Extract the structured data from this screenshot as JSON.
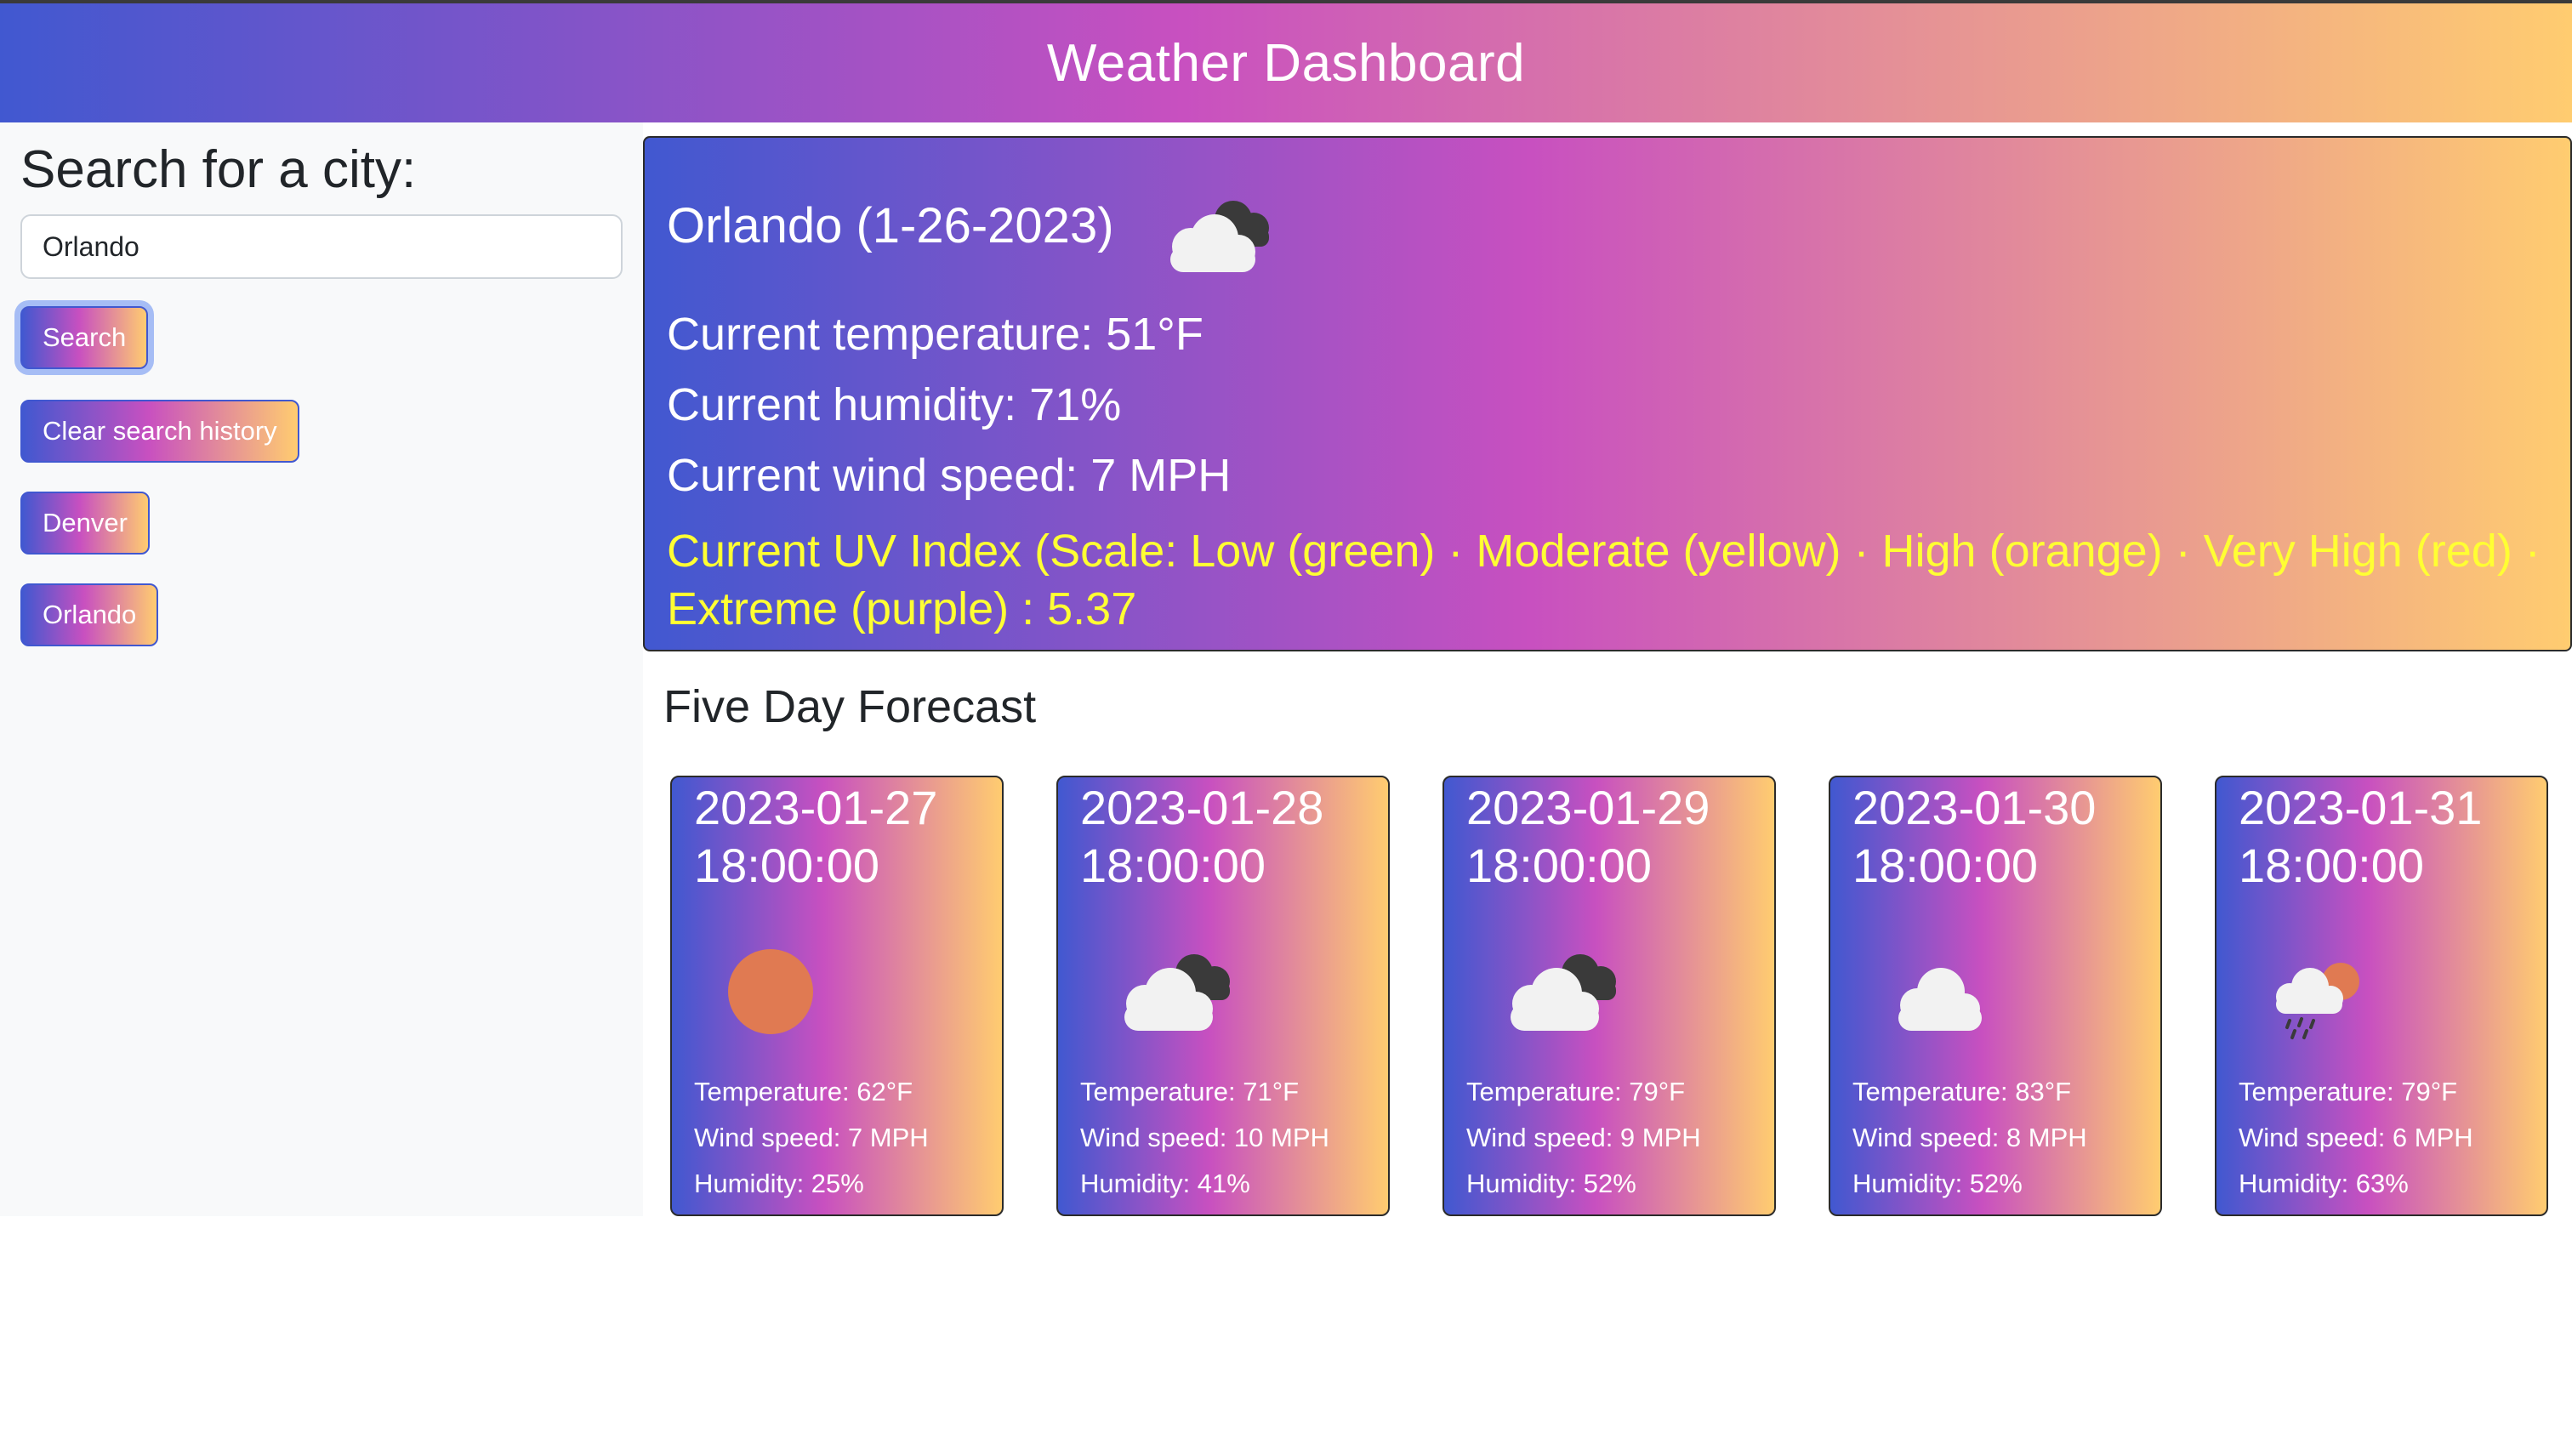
{
  "header": {
    "title": "Weather Dashboard"
  },
  "sidebar": {
    "heading": "Search for a city:",
    "search_value": "Orlando",
    "search_button": "Search",
    "clear_button": "Clear search history",
    "history": [
      "Denver",
      "Orlando"
    ]
  },
  "current": {
    "title": "Orlando (1-26-2023)",
    "icon": "cloudy-icon",
    "temperature": "Current temperature: 51°F",
    "humidity": "Current humidity: 71%",
    "wind": "Current wind speed: 7 MPH",
    "uv": "Current UV Index (Scale: Low (green) · Moderate (yellow) · High (orange) · Very High (red) · Extreme (purple) : 5.37"
  },
  "forecast": {
    "heading": "Five Day Forecast",
    "days": [
      {
        "date": "2023-01-27 18:00:00",
        "icon": "sun-icon",
        "temp": "Temperature: 62°F",
        "wind": "Wind speed: 7 MPH",
        "humidity": "Humidity: 25%"
      },
      {
        "date": "2023-01-28 18:00:00",
        "icon": "cloudy-icon",
        "temp": "Temperature: 71°F",
        "wind": "Wind speed: 10 MPH",
        "humidity": "Humidity: 41%"
      },
      {
        "date": "2023-01-29 18:00:00",
        "icon": "cloudy-icon",
        "temp": "Temperature: 79°F",
        "wind": "Wind speed: 9 MPH",
        "humidity": "Humidity: 52%"
      },
      {
        "date": "2023-01-30 18:00:00",
        "icon": "cloud-icon",
        "temp": "Temperature: 83°F",
        "wind": "Wind speed: 8 MPH",
        "humidity": "Humidity: 52%"
      },
      {
        "date": "2023-01-31 18:00:00",
        "icon": "rain-sun-icon",
        "temp": "Temperature: 79°F",
        "wind": "Wind speed: 6 MPH",
        "humidity": "Humidity: 63%"
      }
    ]
  },
  "colors": {
    "gradient_start": "#4158d0",
    "gradient_mid": "#c850c0",
    "gradient_end": "#ffcc70",
    "uv_text": "#ffff33",
    "sun": "#e07a52"
  }
}
